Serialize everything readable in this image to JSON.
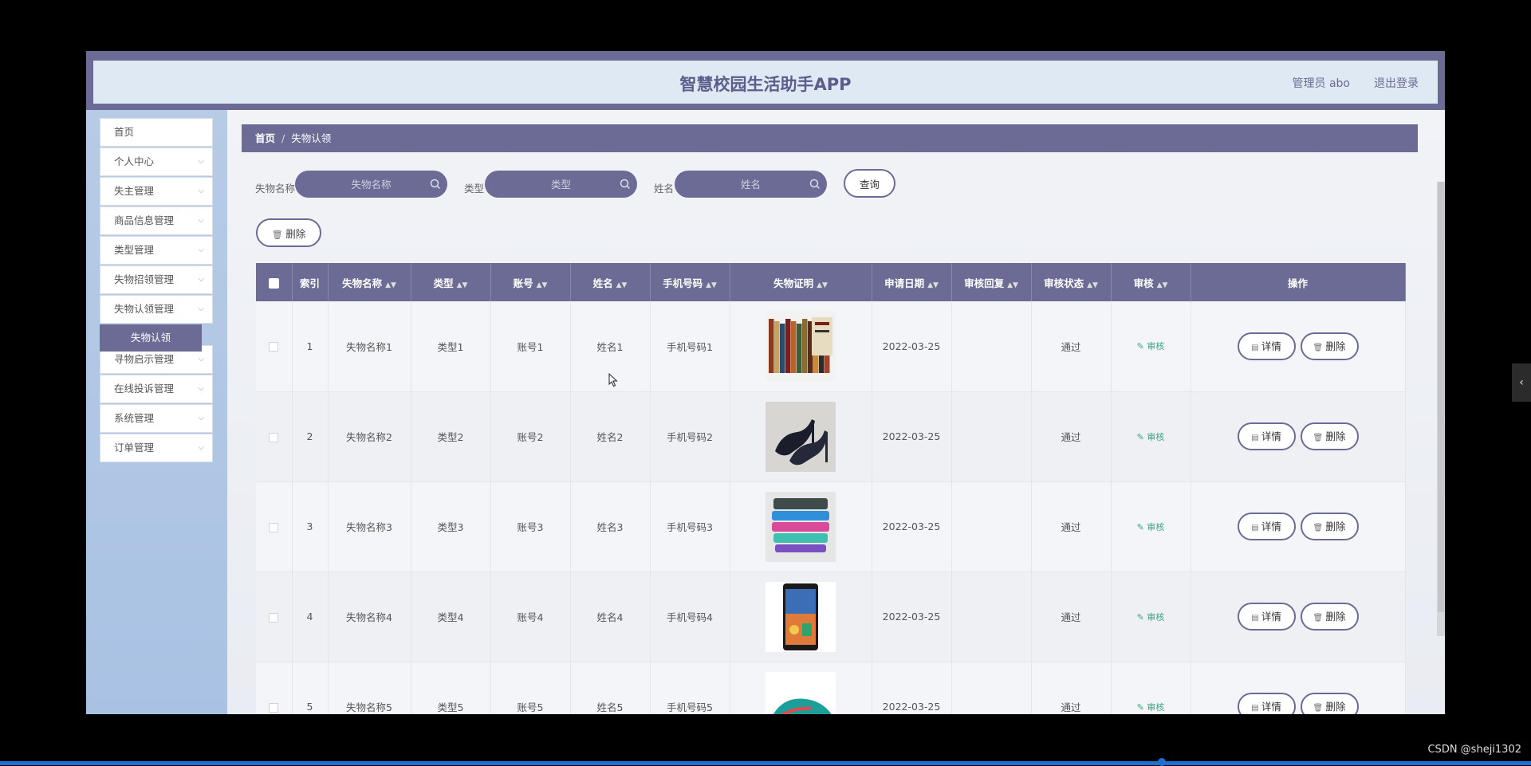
{
  "header": {
    "title": "智慧校园生活助手APP",
    "user": "管理员 abo",
    "logout": "退出登录"
  },
  "sidebar": {
    "items": [
      {
        "label": "首页",
        "chevron": false
      },
      {
        "label": "个人中心",
        "chevron": true
      },
      {
        "label": "失主管理",
        "chevron": true
      },
      {
        "label": "商品信息管理",
        "chevron": true
      },
      {
        "label": "类型管理",
        "chevron": true
      },
      {
        "label": "失物招领管理",
        "chevron": true
      },
      {
        "label": "失物认领管理",
        "chevron": true
      },
      {
        "label": "寻物启示管理",
        "chevron": true
      },
      {
        "label": "在线投诉管理",
        "chevron": true
      },
      {
        "label": "系统管理",
        "chevron": true
      },
      {
        "label": "订单管理",
        "chevron": true
      }
    ],
    "active_sub": "失物认领"
  },
  "breadcrumb": {
    "home": "首页",
    "current": "失物认领"
  },
  "filters": [
    {
      "label": "失物名称",
      "placeholder": "失物名称"
    },
    {
      "label": "类型",
      "placeholder": "类型"
    },
    {
      "label": "姓名",
      "placeholder": "姓名"
    }
  ],
  "query_label": "查询",
  "batch_delete_label": "删除",
  "table": {
    "columns": [
      "索引",
      "失物名称",
      "类型",
      "账号",
      "姓名",
      "手机号码",
      "失物证明",
      "申请日期",
      "审核回复",
      "审核状态",
      "审核",
      "操作"
    ],
    "rows": [
      {
        "idx": "1",
        "name": "失物名称1",
        "type": "类型1",
        "account": "账号1",
        "person": "姓名1",
        "phone": "手机号码1",
        "date": "2022-03-25",
        "reply": "",
        "status": "通过",
        "image": "books"
      },
      {
        "idx": "2",
        "name": "失物名称2",
        "type": "类型2",
        "account": "账号2",
        "person": "姓名2",
        "phone": "手机号码2",
        "date": "2022-03-25",
        "reply": "",
        "status": "通过",
        "image": "heels"
      },
      {
        "idx": "3",
        "name": "失物名称3",
        "type": "类型3",
        "account": "账号3",
        "person": "姓名3",
        "phone": "手机号码3",
        "date": "2022-03-25",
        "reply": "",
        "status": "通过",
        "image": "resistance-bands"
      },
      {
        "idx": "4",
        "name": "失物名称4",
        "type": "类型4",
        "account": "账号4",
        "person": "姓名4",
        "phone": "手机号码4",
        "date": "2022-03-25",
        "reply": "",
        "status": "通过",
        "image": "smartphone"
      },
      {
        "idx": "5",
        "name": "失物名称5",
        "type": "类型5",
        "account": "账号5",
        "person": "姓名5",
        "phone": "手机号码5",
        "date": "2022-03-25",
        "reply": "",
        "status": "通过",
        "image": "sneaker"
      }
    ],
    "audit_label": "审核",
    "detail_label": "详情",
    "delete_label": "删除"
  },
  "watermark": "CSDN @sheji1302",
  "colors": {
    "primary": "#6b6b96",
    "audit": "#3aa57c",
    "progress": "#1f6fd2"
  }
}
